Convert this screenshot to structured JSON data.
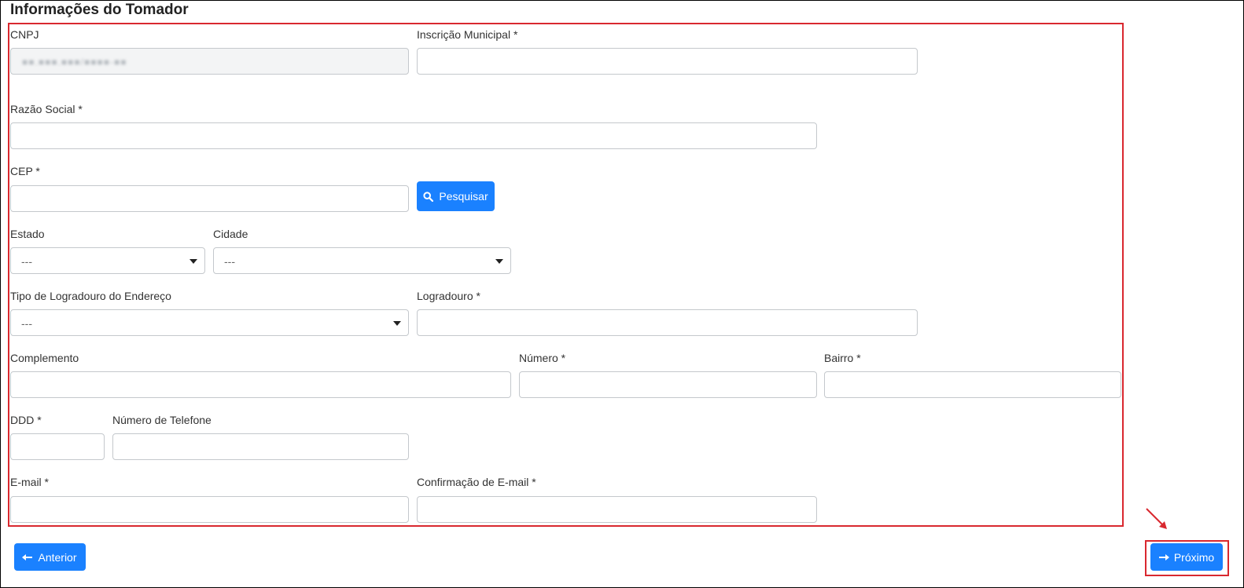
{
  "section_title": "Informações do Tomador",
  "fields": {
    "cnpj": {
      "label": "CNPJ",
      "value": "■■.■■■.■■■/■■■■-■■"
    },
    "inscricao_municipal": {
      "label": "Inscrição Municipal *",
      "value": ""
    },
    "razao_social": {
      "label": "Razão Social *",
      "value": ""
    },
    "cep": {
      "label": "CEP *",
      "value": ""
    },
    "estado": {
      "label": "Estado",
      "selected": "---"
    },
    "cidade": {
      "label": "Cidade",
      "selected": "---"
    },
    "tipo_logradouro": {
      "label": "Tipo de Logradouro do Endereço",
      "selected": "---"
    },
    "logradouro": {
      "label": "Logradouro *",
      "value": ""
    },
    "complemento": {
      "label": "Complemento",
      "value": ""
    },
    "numero": {
      "label": "Número *",
      "value": ""
    },
    "bairro": {
      "label": "Bairro *",
      "value": ""
    },
    "ddd": {
      "label": "DDD *",
      "value": ""
    },
    "telefone": {
      "label": "Número de Telefone",
      "value": ""
    },
    "email": {
      "label": "E-mail *",
      "value": ""
    },
    "email_confirm": {
      "label": "Confirmação de E-mail *",
      "value": ""
    }
  },
  "buttons": {
    "pesquisar": "Pesquisar",
    "anterior": "Anterior",
    "proximo": "Próximo"
  },
  "colors": {
    "primary": "#1a81ff",
    "highlight": "#d9282f"
  }
}
